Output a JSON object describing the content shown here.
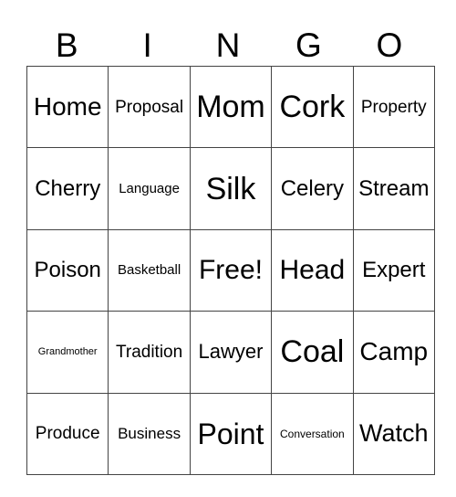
{
  "header": [
    "B",
    "I",
    "N",
    "G",
    "O"
  ],
  "cells": [
    [
      {
        "text": "Home",
        "size": 28
      },
      {
        "text": "Proposal",
        "size": 19
      },
      {
        "text": "Mom",
        "size": 34
      },
      {
        "text": "Cork",
        "size": 34
      },
      {
        "text": "Property",
        "size": 19
      }
    ],
    [
      {
        "text": "Cherry",
        "size": 24
      },
      {
        "text": "Language",
        "size": 15
      },
      {
        "text": "Silk",
        "size": 34
      },
      {
        "text": "Celery",
        "size": 24
      },
      {
        "text": "Stream",
        "size": 24
      }
    ],
    [
      {
        "text": "Poison",
        "size": 24
      },
      {
        "text": "Basketball",
        "size": 15
      },
      {
        "text": "Free!",
        "size": 30
      },
      {
        "text": "Head",
        "size": 30
      },
      {
        "text": "Expert",
        "size": 24
      }
    ],
    [
      {
        "text": "Grandmother",
        "size": 11
      },
      {
        "text": "Tradition",
        "size": 19
      },
      {
        "text": "Lawyer",
        "size": 22
      },
      {
        "text": "Coal",
        "size": 34
      },
      {
        "text": "Camp",
        "size": 28
      }
    ],
    [
      {
        "text": "Produce",
        "size": 19
      },
      {
        "text": "Business",
        "size": 17
      },
      {
        "text": "Point",
        "size": 32
      },
      {
        "text": "Conversation",
        "size": 12
      },
      {
        "text": "Watch",
        "size": 27
      }
    ]
  ]
}
